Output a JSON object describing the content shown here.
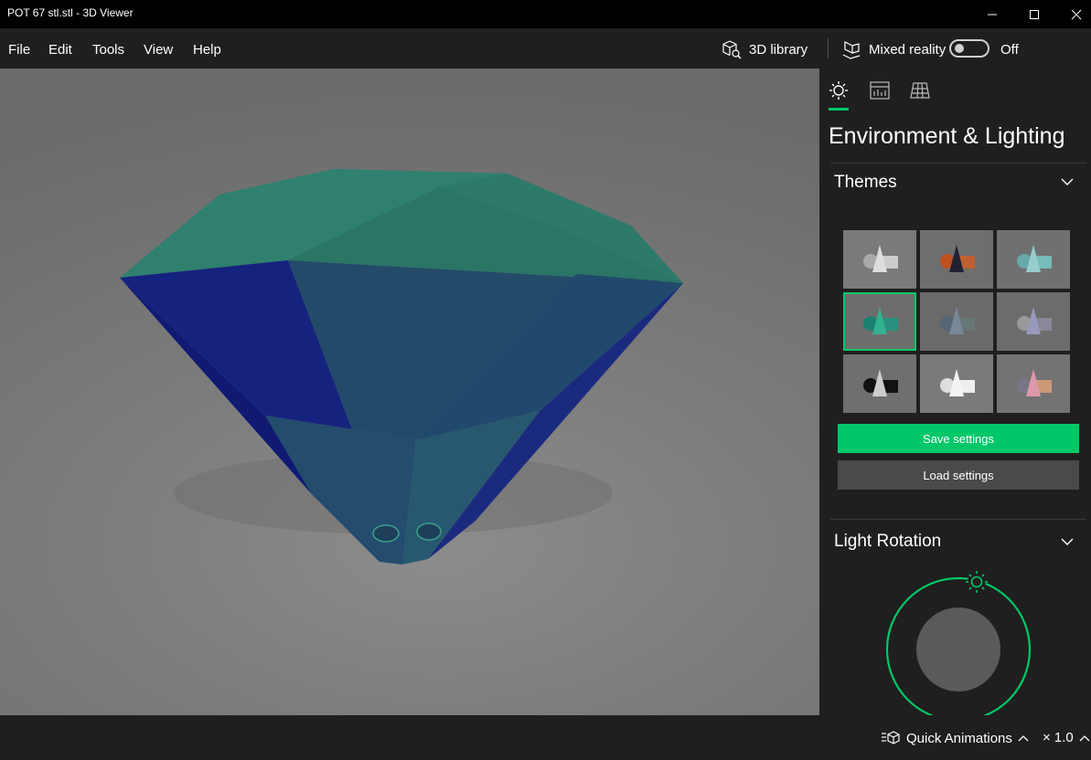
{
  "window": {
    "title": "POT 67 stl.stl - 3D Viewer"
  },
  "menu": {
    "items": [
      "File",
      "Edit",
      "Tools",
      "View",
      "Help"
    ]
  },
  "toolbar": {
    "library_label": "3D library",
    "mixed_reality_label": "Mixed reality",
    "toggle_state": "Off"
  },
  "panel": {
    "title": "Environment & Lighting",
    "tabs": [
      "sun-icon",
      "stats-icon",
      "grid-icon"
    ],
    "active_tab": 0,
    "themes_title": "Themes",
    "selected_theme": 3,
    "save_label": "Save settings",
    "load_label": "Load settings",
    "light_rotation_title": "Light Rotation"
  },
  "colors": {
    "accent": "#00c868",
    "panel_bg": "#1f1f1f",
    "model_top": "#2a7d6b",
    "model_side": "#1a2a8a"
  },
  "status": {
    "quick_animations_label": "Quick Animations",
    "zoom_label": "× 1.0"
  }
}
